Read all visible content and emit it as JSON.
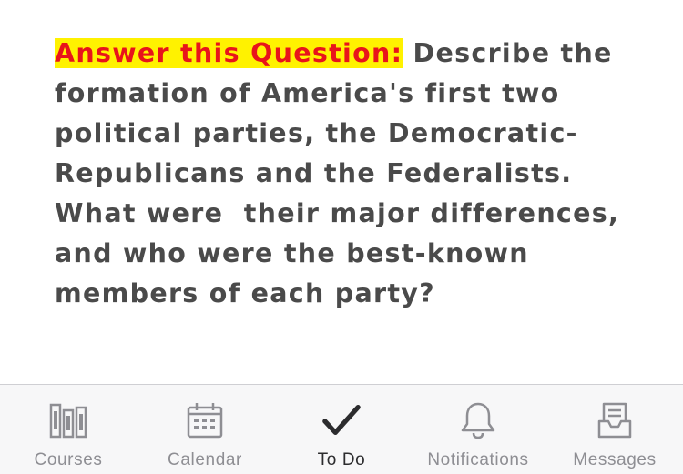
{
  "question": {
    "prefix": "Answer this Question:",
    "text": " Describe the formation of America's first two political parties, the Democratic-Republicans and the Federalists.  What were  their major differences, and who were the best-known members of each party?"
  },
  "colors": {
    "highlight_bg": "#fff200",
    "highlight_text": "#e8141b",
    "body_text": "#4a4a4a",
    "tab_inactive": "#8e8e93",
    "tab_active": "#2c2c2e"
  },
  "tabbar": {
    "active": "To Do",
    "tabs": [
      {
        "label": "Courses",
        "icon": "courses-icon"
      },
      {
        "label": "Calendar",
        "icon": "calendar-icon"
      },
      {
        "label": "To Do",
        "icon": "checkmark-icon"
      },
      {
        "label": "Notifications",
        "icon": "bell-icon"
      },
      {
        "label": "Messages",
        "icon": "inbox-icon"
      }
    ]
  }
}
